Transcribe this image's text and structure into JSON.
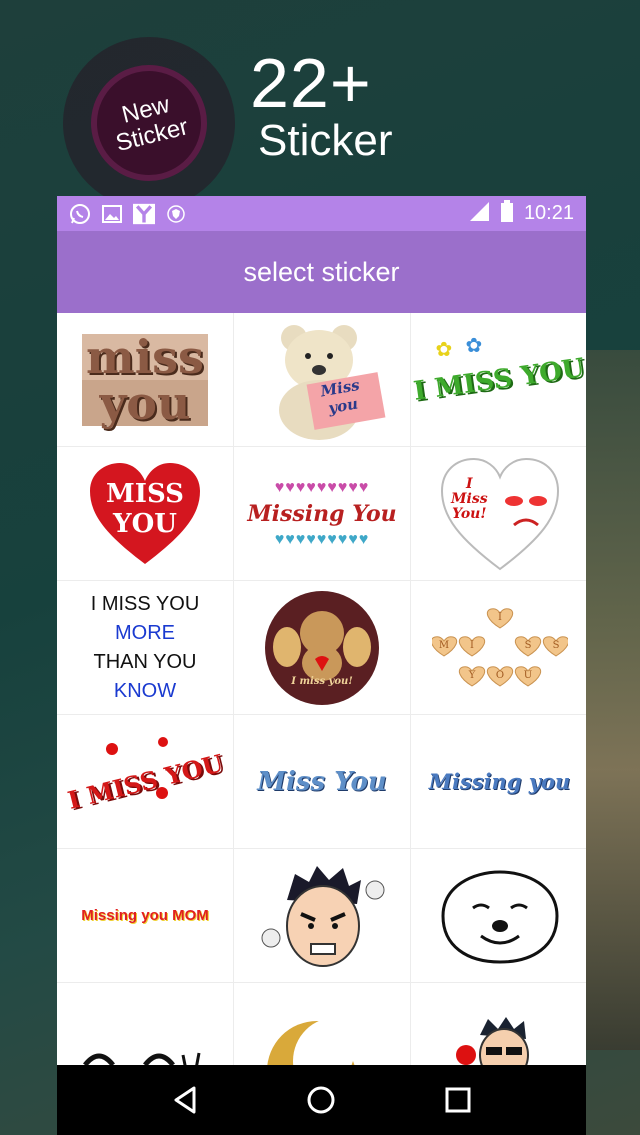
{
  "promo": {
    "badge_line1": "New",
    "badge_line2": "Sticker",
    "count": "22+",
    "label": "Sticker"
  },
  "statusbar": {
    "time": "10:21",
    "icons": [
      "whatsapp-icon",
      "gallery-icon",
      "y-app-icon",
      "shield-icon",
      "signal-icon",
      "battery-icon"
    ]
  },
  "appbar": {
    "title": "select sticker"
  },
  "stickers": [
    {
      "line1": "miss",
      "line2": "you"
    },
    {
      "line1": "Miss",
      "line2": "you"
    },
    {
      "text": "I MISS YOU"
    },
    {
      "line1": "MISS",
      "line2": "YOU"
    },
    {
      "text": "Missing You"
    },
    {
      "line1": "I",
      "line2": "Miss",
      "line3": "You!"
    },
    {
      "line1": "I MISS YOU",
      "line2": "MORE",
      "line3": "THAN YOU",
      "line4": "KNOW"
    },
    {
      "text": "I miss you!"
    },
    {
      "letters": [
        "I",
        "M",
        "I",
        "S",
        "S",
        "Y",
        "O",
        "U"
      ]
    },
    {
      "text": "I MISS YOU"
    },
    {
      "text": "Miss You"
    },
    {
      "text": "Missing you"
    },
    {
      "text": "Missing you MOM"
    },
    {
      "name": "angry-boy"
    },
    {
      "name": "smiling-dog"
    },
    {
      "name": "laughing-face"
    },
    {
      "name": "crescent-star"
    },
    {
      "name": "boy-with-rose"
    }
  ],
  "colors": {
    "statusbar": "#b483e8",
    "appbar": "#9b6fcb",
    "navbar": "#000000"
  }
}
